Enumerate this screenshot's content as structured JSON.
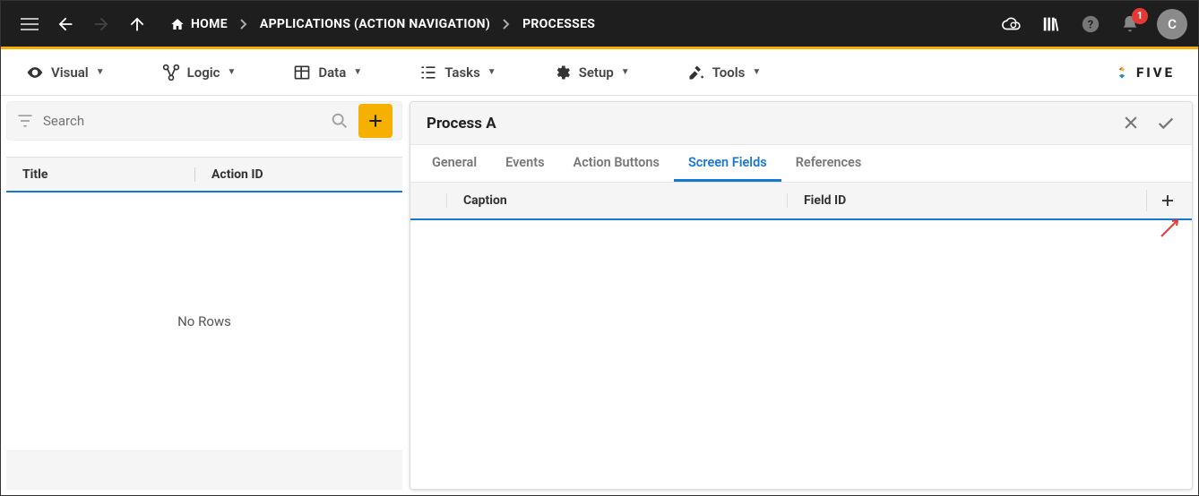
{
  "breadcrumb": {
    "home": "HOME",
    "apps": "APPLICATIONS (ACTION NAVIGATION)",
    "proc": "PROCESSES"
  },
  "notifications": {
    "count": "1"
  },
  "avatar_initial": "C",
  "toolbar": {
    "visual": "Visual",
    "logic": "Logic",
    "data": "Data",
    "tasks": "Tasks",
    "setup": "Setup",
    "tools": "Tools"
  },
  "brand": "FIVE",
  "left": {
    "search_placeholder": "Search",
    "th_title": "Title",
    "th_actionid": "Action ID",
    "no_rows": "No Rows"
  },
  "right": {
    "title": "Process A",
    "tabs": {
      "general": "General",
      "events": "Events",
      "action_buttons": "Action Buttons",
      "screen_fields": "Screen Fields",
      "references": "References"
    },
    "sub": {
      "caption": "Caption",
      "field_id": "Field ID"
    }
  }
}
